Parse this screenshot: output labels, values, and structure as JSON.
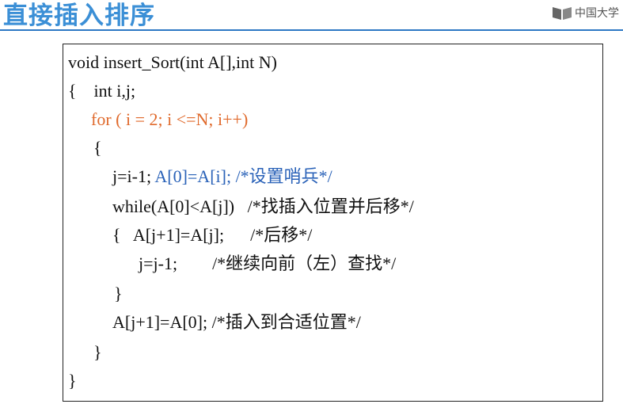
{
  "slide": {
    "title": "直接插入排序",
    "logo_text": "中国大学",
    "logo_icon": "book-icon"
  },
  "code": {
    "l1": "void insert_Sort(int A[],int N)",
    "l2": "{    int i,j;",
    "l3": "for ( i = 2; i <=N; i++)",
    "l4": "{",
    "l5a": "j=i-1; ",
    "l5b": "A[0]=A[i]; /*设置哨兵*/",
    "l6": "while(A[0]<A[j])   /*找插入位置并后移*/",
    "l7": "{   A[j+1]=A[j];      /*后移*/",
    "l8": "j=j-1;        /*继续向前（左）查找*/",
    "l9": "}",
    "l10": "A[j+1]=A[0]; /*插入到合适位置*/",
    "l11": "}",
    "l12": "}"
  },
  "colors": {
    "title": "#3b8fd6",
    "keyword_highlight": "#e06a2c",
    "sentinel_highlight": "#2a62b8"
  }
}
